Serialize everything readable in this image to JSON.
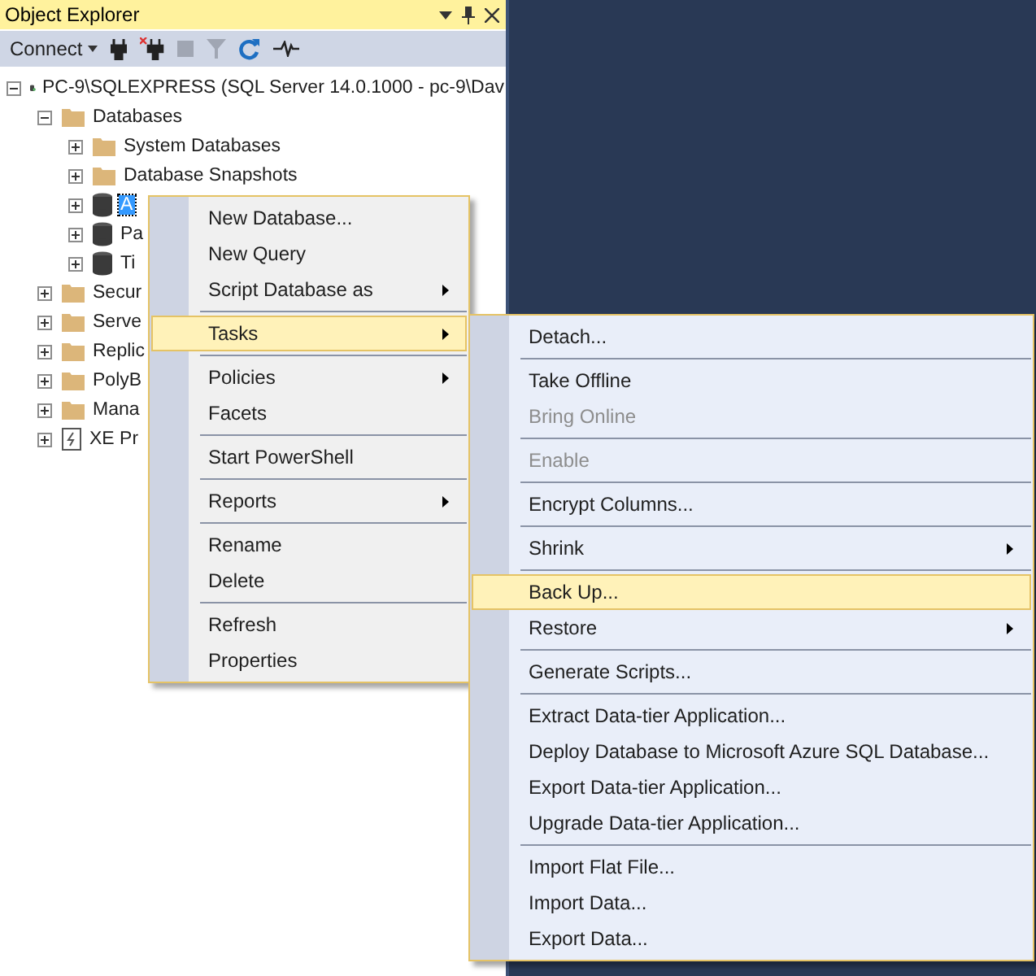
{
  "panel": {
    "title": "Object Explorer",
    "connect": "Connect",
    "tree": [
      {
        "label": "PC-9\\SQLEXPRESS (SQL Server 14.0.1000 - pc-9\\Dav",
        "kind": "server",
        "expanded": true,
        "selected": false,
        "children": [
          {
            "label": "Databases",
            "kind": "folder",
            "expanded": true,
            "selected": false,
            "children": [
              {
                "label": "System Databases",
                "kind": "folder",
                "expanded": false,
                "selected": false
              },
              {
                "label": "Database Snapshots",
                "kind": "folder",
                "expanded": false,
                "selected": false
              },
              {
                "label": "A",
                "kind": "database",
                "expanded": false,
                "selected": true
              },
              {
                "label": "Pa",
                "kind": "database",
                "expanded": false,
                "selected": false
              },
              {
                "label": "Ti",
                "kind": "database",
                "expanded": false,
                "selected": false
              }
            ]
          },
          {
            "label": "Secur",
            "kind": "folder",
            "expanded": false,
            "selected": false
          },
          {
            "label": "Serve",
            "kind": "folder",
            "expanded": false,
            "selected": false
          },
          {
            "label": "Replic",
            "kind": "folder",
            "expanded": false,
            "selected": false
          },
          {
            "label": "PolyB",
            "kind": "folder",
            "expanded": false,
            "selected": false
          },
          {
            "label": "Mana",
            "kind": "folder",
            "expanded": false,
            "selected": false
          },
          {
            "label": "XE Pr",
            "kind": "xe",
            "expanded": false,
            "selected": false
          }
        ]
      }
    ]
  },
  "context_menu": [
    {
      "kind": "item",
      "label": "New Database...",
      "submenu": false,
      "selected": false,
      "disabled": false
    },
    {
      "kind": "item",
      "label": "New Query",
      "submenu": false,
      "selected": false,
      "disabled": false
    },
    {
      "kind": "item",
      "label": "Script Database as",
      "submenu": true,
      "selected": false,
      "disabled": false
    },
    {
      "kind": "separator"
    },
    {
      "kind": "item",
      "label": "Tasks",
      "submenu": true,
      "selected": true,
      "disabled": false
    },
    {
      "kind": "separator"
    },
    {
      "kind": "item",
      "label": "Policies",
      "submenu": true,
      "selected": false,
      "disabled": false
    },
    {
      "kind": "item",
      "label": "Facets",
      "submenu": false,
      "selected": false,
      "disabled": false
    },
    {
      "kind": "separator"
    },
    {
      "kind": "item",
      "label": "Start PowerShell",
      "submenu": false,
      "selected": false,
      "disabled": false
    },
    {
      "kind": "separator"
    },
    {
      "kind": "item",
      "label": "Reports",
      "submenu": true,
      "selected": false,
      "disabled": false
    },
    {
      "kind": "separator"
    },
    {
      "kind": "item",
      "label": "Rename",
      "submenu": false,
      "selected": false,
      "disabled": false
    },
    {
      "kind": "item",
      "label": "Delete",
      "submenu": false,
      "selected": false,
      "disabled": false
    },
    {
      "kind": "separator"
    },
    {
      "kind": "item",
      "label": "Refresh",
      "submenu": false,
      "selected": false,
      "disabled": false
    },
    {
      "kind": "item",
      "label": "Properties",
      "submenu": false,
      "selected": false,
      "disabled": false
    }
  ],
  "tasks_submenu": [
    {
      "kind": "item",
      "label": "Detach...",
      "submenu": false,
      "selected": false,
      "disabled": false
    },
    {
      "kind": "separator"
    },
    {
      "kind": "item",
      "label": "Take Offline",
      "submenu": false,
      "selected": false,
      "disabled": false
    },
    {
      "kind": "item",
      "label": "Bring Online",
      "submenu": false,
      "selected": false,
      "disabled": true
    },
    {
      "kind": "separator"
    },
    {
      "kind": "item",
      "label": "Enable",
      "submenu": false,
      "selected": false,
      "disabled": true
    },
    {
      "kind": "separator"
    },
    {
      "kind": "item",
      "label": "Encrypt Columns...",
      "submenu": false,
      "selected": false,
      "disabled": false
    },
    {
      "kind": "separator"
    },
    {
      "kind": "item",
      "label": "Shrink",
      "submenu": true,
      "selected": false,
      "disabled": false
    },
    {
      "kind": "separator"
    },
    {
      "kind": "item",
      "label": "Back Up...",
      "submenu": false,
      "selected": true,
      "disabled": false
    },
    {
      "kind": "item",
      "label": "Restore",
      "submenu": true,
      "selected": false,
      "disabled": false
    },
    {
      "kind": "separator"
    },
    {
      "kind": "item",
      "label": "Generate Scripts...",
      "submenu": false,
      "selected": false,
      "disabled": false
    },
    {
      "kind": "separator"
    },
    {
      "kind": "item",
      "label": "Extract Data-tier Application...",
      "submenu": false,
      "selected": false,
      "disabled": false
    },
    {
      "kind": "item",
      "label": "Deploy Database to Microsoft Azure SQL Database...",
      "submenu": false,
      "selected": false,
      "disabled": false
    },
    {
      "kind": "item",
      "label": "Export Data-tier Application...",
      "submenu": false,
      "selected": false,
      "disabled": false
    },
    {
      "kind": "item",
      "label": "Upgrade Data-tier Application...",
      "submenu": false,
      "selected": false,
      "disabled": false
    },
    {
      "kind": "separator"
    },
    {
      "kind": "item",
      "label": "Import Flat File...",
      "submenu": false,
      "selected": false,
      "disabled": false
    },
    {
      "kind": "item",
      "label": "Import Data...",
      "submenu": false,
      "selected": false,
      "disabled": false
    },
    {
      "kind": "item",
      "label": "Export Data...",
      "submenu": false,
      "selected": false,
      "disabled": false
    }
  ]
}
